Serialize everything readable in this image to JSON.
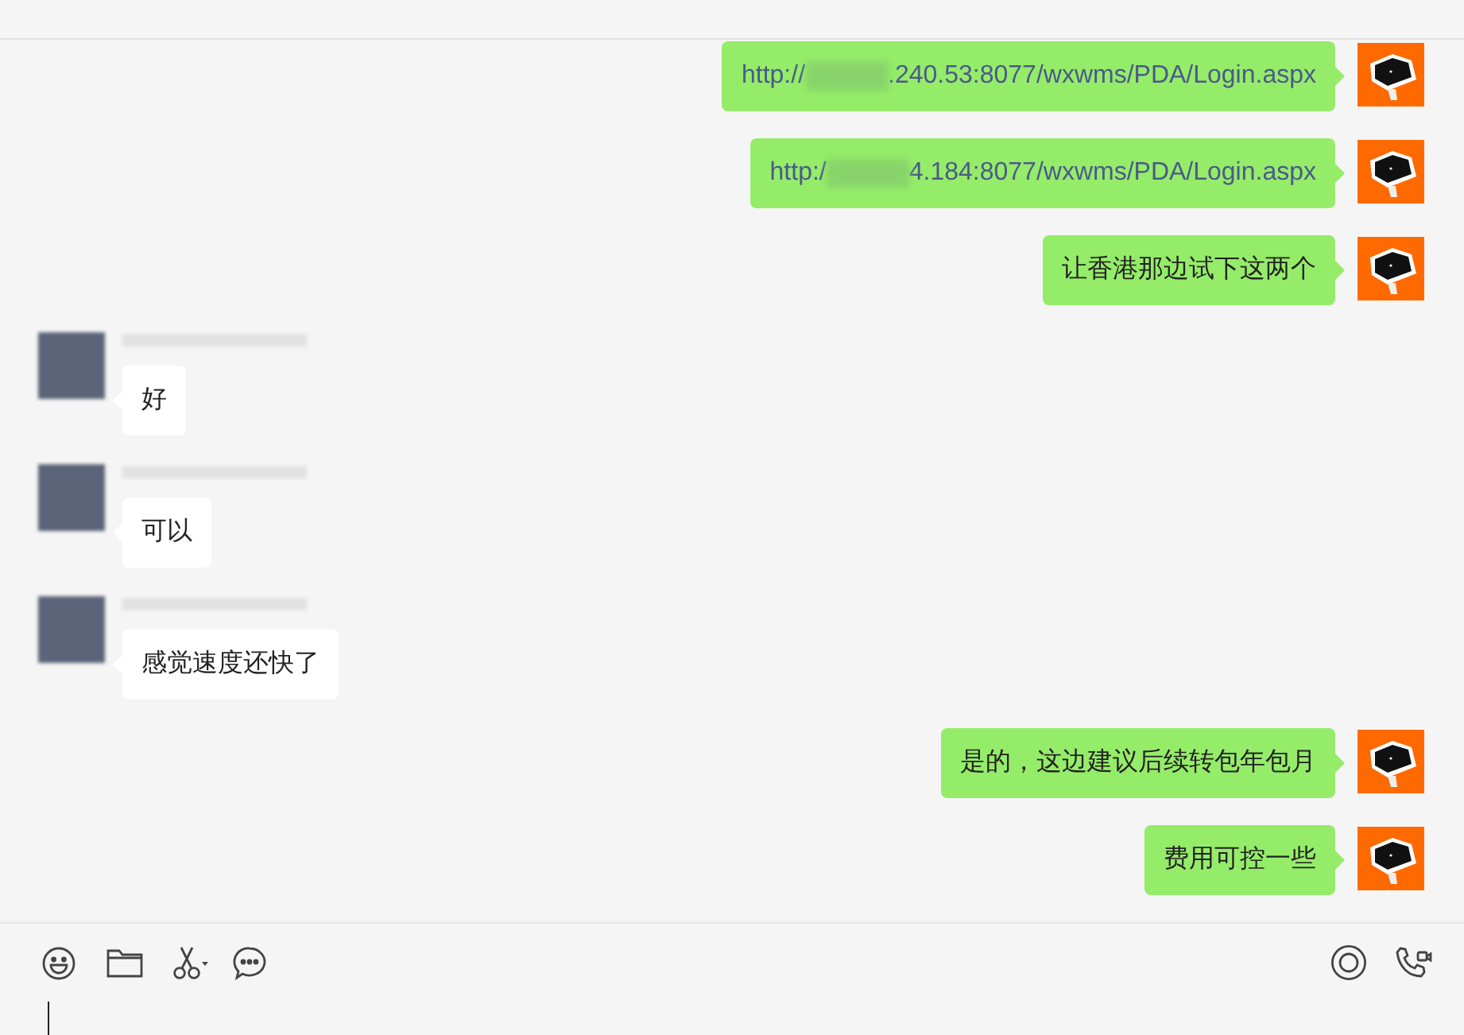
{
  "messages": [
    {
      "kind": "outgoing",
      "parts": [
        {
          "kind": "text",
          "text": "http://"
        },
        {
          "kind": "redacted"
        },
        {
          "kind": "text",
          "text": ".240.53:8077/wxwms/PDA/Login.aspx"
        }
      ]
    },
    {
      "kind": "outgoing",
      "parts": [
        {
          "kind": "text",
          "text": "http:/"
        },
        {
          "kind": "redacted"
        },
        {
          "kind": "text",
          "text": "4.184:8077/wxwms/PDA/Login.aspx"
        }
      ]
    },
    {
      "kind": "outgoing",
      "parts": [
        {
          "kind": "text",
          "text": "让香港那边试下这两个"
        }
      ]
    },
    {
      "kind": "incoming",
      "parts": [
        {
          "kind": "text",
          "text": "好"
        }
      ]
    },
    {
      "kind": "incoming",
      "parts": [
        {
          "kind": "text",
          "text": "可以"
        }
      ]
    },
    {
      "kind": "incoming",
      "parts": [
        {
          "kind": "text",
          "text": "感觉速度还快了"
        }
      ]
    },
    {
      "kind": "outgoing",
      "parts": [
        {
          "kind": "text",
          "text": "是的，这边建议后续转包年包月"
        }
      ]
    },
    {
      "kind": "outgoing",
      "parts": [
        {
          "kind": "text",
          "text": "费用可控一些"
        }
      ]
    }
  ]
}
